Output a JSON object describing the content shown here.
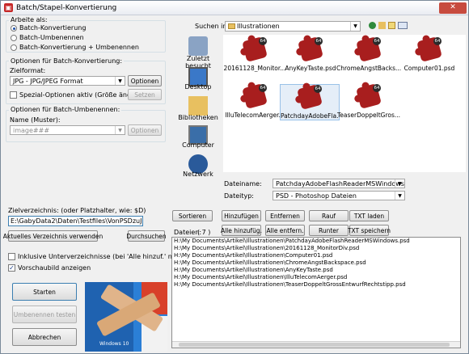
{
  "window": {
    "title": "Batch/Stapel-Konvertierung"
  },
  "work": {
    "legend": "Arbeite als:",
    "options": [
      "Batch-Konvertierung",
      "Batch-Umbenennen",
      "Batch-Konvertierung + Umbenennen"
    ],
    "selected": 0
  },
  "convert": {
    "legend": "Optionen für Batch-Konvertierung:",
    "format_label": "Zielformat:",
    "format_value": "JPG - JPG/JPEG Format",
    "options_btn": "Optionen",
    "special_label": "Spezial-Optionen aktiv (Größe ändern etc.)",
    "set_btn": "Setzen"
  },
  "rename": {
    "legend": "Optionen für Batch-Umbenennen:",
    "name_label": "Name (Muster):",
    "name_value": "image###",
    "options_btn": "Optionen"
  },
  "target": {
    "label": "Zielverzeichnis: (oder Platzhalter, wie: $D)",
    "value": "E:\\GabyData2\\Daten\\Testfiles\\VonPSDzuJPG\\",
    "use_current_btn": "Aktuelles Verzeichnis verwenden",
    "browse_btn": "Durchsuchen",
    "subdirs_label": "Inklusive Unterverzeichnisse (bei 'Alle hinzuf.' nicht gesp.)",
    "preview_label": "Vorschaubild anzeigen"
  },
  "actions": {
    "start": "Starten",
    "rename_test": "Umbenennen testen",
    "cancel": "Abbrechen"
  },
  "preview": {
    "caption": "Windows 10"
  },
  "browser": {
    "lookin_label": "Suchen in:",
    "folder": "Illustrationen",
    "places": [
      "Zuletzt besucht",
      "Desktop",
      "Bibliotheken",
      "Computer",
      "Netzwerk"
    ],
    "files": [
      "20161128_Monitor...",
      "AnyKeyTaste.psd",
      "ChromeAngstBacks...",
      "Computer01.psd",
      "IlluTelecomAerger...",
      "PatchdayAdobeFla...",
      "TeaserDoppeltGros..."
    ],
    "badge": "64",
    "selected_file": 5,
    "filename_label": "Dateiname:",
    "filename_value": "PatchdayAdobeFlashReaderMSWindows.psd",
    "filetype_label": "Dateityp:",
    "filetype_value": "PSD - Photoshop Dateien"
  },
  "listctl": {
    "sort": "Sortieren",
    "add": "Hinzufügen",
    "remove": "Entfernen",
    "up": "Rauf",
    "load_txt": "TXT laden",
    "files_label": "Dateien:",
    "files_count": "( 7 )",
    "add_all": "Alle hinzufüg.",
    "remove_all": "Alle entfern.",
    "down": "Runter",
    "save_txt": "TXT speichern"
  },
  "filelist": [
    "H:\\My Documents\\Artikel\\Illustrationen\\PatchdayAdobeFlashReaderMSWindows.psd",
    "H:\\My Documents\\Artikel\\Illustrationen\\20161128_MonitorDiv.psd",
    "H:\\My Documents\\Artikel\\Illustrationen\\Computer01.psd",
    "H:\\My Documents\\Artikel\\Illustrationen\\ChromeAngstBackspace.psd",
    "H:\\My Documents\\Artikel\\Illustrationen\\AnyKeyTaste.psd",
    "H:\\My Documents\\Artikel\\Illustrationen\\IlluTelecomAerger.psd",
    "H:\\My Documents\\Artikel\\Illustrationen\\TeaserDoppeltGrossEntwurfRechtstipp.psd"
  ],
  "colors": {
    "accent": "#1c4fa8",
    "icon_red": "#a81e1e"
  }
}
